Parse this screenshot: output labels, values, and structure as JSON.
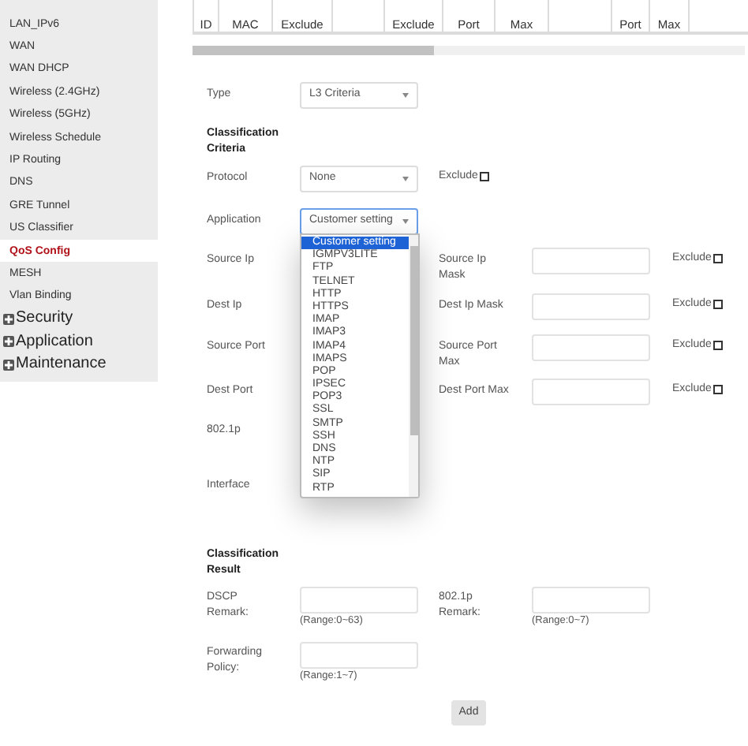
{
  "sidebar": {
    "items": [
      {
        "label": "LAN_IPv6",
        "kind": "link",
        "selected": false
      },
      {
        "label": "WAN",
        "kind": "link",
        "selected": false
      },
      {
        "label": "WAN DHCP",
        "kind": "link",
        "selected": false
      },
      {
        "label": "Wireless (2.4GHz)",
        "kind": "link",
        "selected": false
      },
      {
        "label": "Wireless (5GHz)",
        "kind": "link",
        "selected": false
      },
      {
        "label": "Wireless Schedule",
        "kind": "link",
        "selected": false
      },
      {
        "label": "IP Routing",
        "kind": "link",
        "selected": false
      },
      {
        "label": "DNS",
        "kind": "link",
        "selected": false
      },
      {
        "label": "GRE Tunnel",
        "kind": "link",
        "selected": false
      },
      {
        "label": "US Classifier",
        "kind": "link",
        "selected": false
      },
      {
        "label": "QoS Config",
        "kind": "link",
        "selected": true
      },
      {
        "label": "MESH",
        "kind": "link",
        "selected": false
      },
      {
        "label": "Vlan Binding",
        "kind": "link",
        "selected": false
      },
      {
        "label": "Security",
        "kind": "group"
      },
      {
        "label": "Application",
        "kind": "group"
      },
      {
        "label": "Maintenance",
        "kind": "group"
      }
    ]
  },
  "table": {
    "columns": [
      {
        "label": "ID"
      },
      {
        "label": "MAC"
      },
      {
        "label": "Exclude"
      },
      {},
      {
        "label": "Exclude"
      },
      {
        "label": "Port"
      },
      {
        "label": "Max"
      },
      {},
      {
        "label": "Port"
      },
      {
        "label": "Max"
      },
      {}
    ]
  },
  "form": {
    "rows": [
      {
        "kind": "select",
        "label": "Type",
        "value": "L3 Criteria"
      },
      {
        "kind": "heading",
        "label": "Classification Criteria"
      },
      {
        "kind": "select",
        "label": "Protocol",
        "value": "None",
        "exclude": {
          "label": "Exclude",
          "checked": false
        }
      },
      {
        "kind": "open-select",
        "label": "Application",
        "value": "Customer setting"
      },
      {
        "kind": "pair",
        "label": "Source Ip",
        "label_2": "Source Ip Mask",
        "exclude": {
          "label": "Exclude",
          "checked": false
        }
      },
      {
        "kind": "pair",
        "label": "Dest Ip",
        "label_2": "Dest Ip Mask",
        "exclude": {
          "label": "Exclude",
          "checked": false
        }
      },
      {
        "kind": "pair",
        "label": "Source Port",
        "label_2": "Source Port Max",
        "exclude": {
          "label": "Exclude",
          "checked": false
        }
      },
      {
        "kind": "pair",
        "label": "Dest Port",
        "label_2": "Dest Port Max",
        "exclude": {
          "label": "Exclude",
          "checked": false
        }
      },
      {
        "kind": "plain",
        "label": "802.1p"
      },
      {
        "kind": "plain",
        "label": "Interface"
      },
      {
        "kind": "heading",
        "label": "Classification Result"
      },
      {
        "kind": "inputs",
        "label": "DSCP Remark:",
        "range": "(Range:0~63)",
        "label_2": "802.1p Remark:",
        "range_2": "(Range:0~7)"
      },
      {
        "kind": "inputs",
        "label": "Forwarding Policy:",
        "range": "(Range:1~7)"
      }
    ],
    "dropdown": {
      "options": [
        {
          "label": "Customer setting",
          "selected": true
        },
        {
          "label": "IGMPV3LITE",
          "selected": false
        },
        {
          "label": "FTP",
          "selected": false
        },
        {
          "label": "TELNET",
          "selected": false
        },
        {
          "label": "HTTP",
          "selected": false
        },
        {
          "label": "HTTPS",
          "selected": false
        },
        {
          "label": "IMAP",
          "selected": false
        },
        {
          "label": "IMAP3",
          "selected": false
        },
        {
          "label": "IMAP4",
          "selected": false
        },
        {
          "label": "IMAPS",
          "selected": false
        },
        {
          "label": "POP",
          "selected": false
        },
        {
          "label": "IPSEC",
          "selected": false
        },
        {
          "label": "POP3",
          "selected": false
        },
        {
          "label": "SSL",
          "selected": false
        },
        {
          "label": "SMTP",
          "selected": false
        },
        {
          "label": "SSH",
          "selected": false
        },
        {
          "label": "DNS",
          "selected": false
        },
        {
          "label": "NTP",
          "selected": false
        },
        {
          "label": "SIP",
          "selected": false
        },
        {
          "label": "RTP",
          "selected": false
        }
      ]
    },
    "add_button": "Add"
  }
}
